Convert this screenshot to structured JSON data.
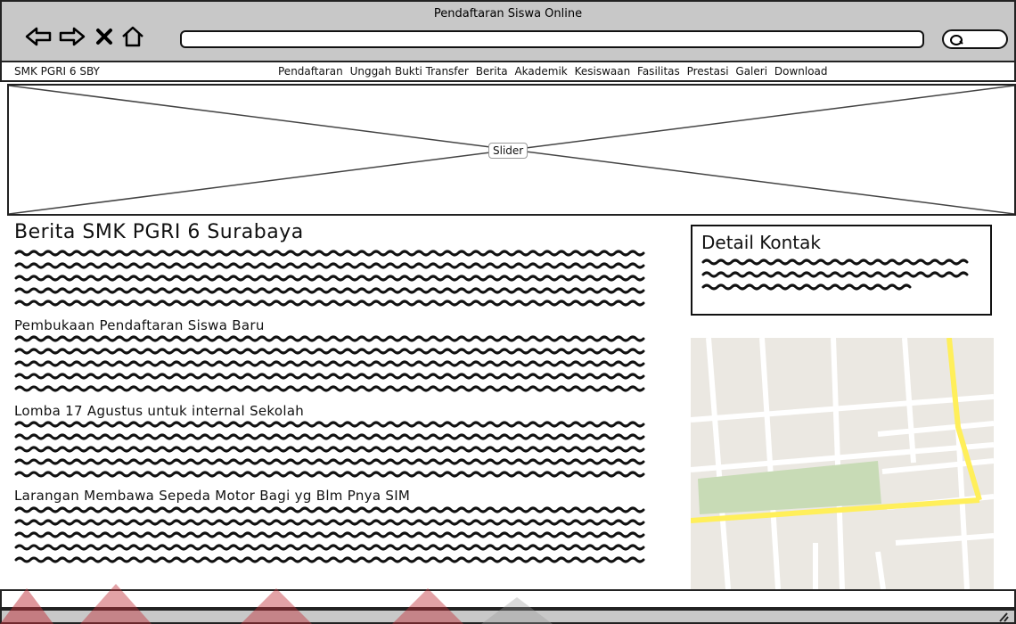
{
  "window": {
    "title": "Pendaftaran Siswa Online"
  },
  "toolbar": {
    "back_icon": "back-arrow-icon",
    "forward_icon": "forward-arrow-icon",
    "stop_icon": "close-icon",
    "home_icon": "home-icon",
    "address_value": "",
    "search_icon": "search-icon"
  },
  "nav": {
    "site_name": "SMK PGRI 6 SBY",
    "links": [
      "Pendaftaran",
      "Unggah Bukti Transfer",
      "Berita",
      "Akademik",
      "Kesiswaan",
      "Fasilitas",
      "Prestasi",
      "Galeri",
      "Download"
    ]
  },
  "slider": {
    "label": "Slider"
  },
  "main": {
    "title": "Berita SMK PGRI 6 Surabaya",
    "news": [
      {
        "title": "Pembukaan Pendaftaran Siswa Baru"
      },
      {
        "title": "Lomba 17 Agustus untuk internal Sekolah"
      },
      {
        "title": "Larangan Membawa Sepeda Motor Bagi yg Blm Pnya SIM"
      }
    ]
  },
  "sidebar": {
    "contact_title": "Detail Kontak"
  },
  "colors": {
    "chrome": "#c8c8c8",
    "map_bg": "#ebe8e2",
    "map_road": "#ffef5a",
    "map_park": "#c8dbb6",
    "watermark": "#c0303a"
  }
}
